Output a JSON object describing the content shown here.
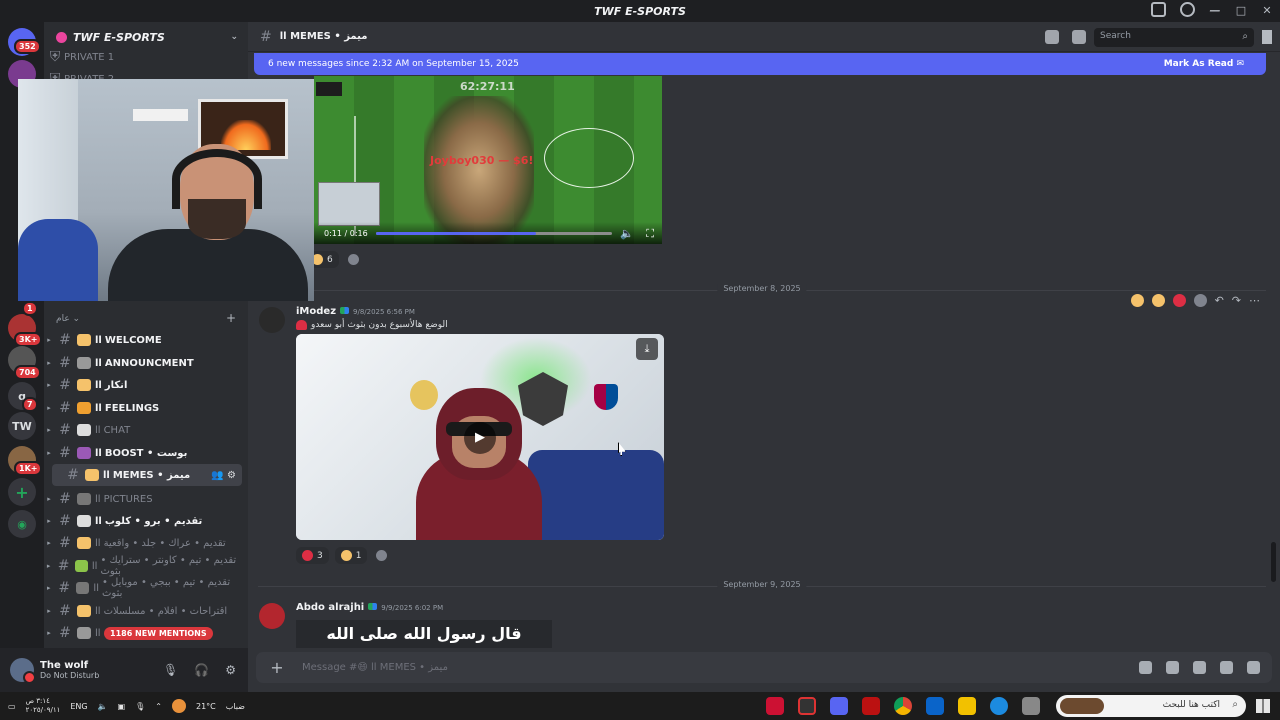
{
  "window": {
    "title": "TWF E-SPORTS",
    "controls": [
      "—",
      "□",
      "✕"
    ]
  },
  "guilds": [
    {
      "label": "",
      "badge": "352",
      "color": "#5865f2"
    },
    {
      "label": "",
      "badge": "",
      "color": "#7a3b8f"
    },
    {
      "label": "",
      "badge": "1",
      "color": "#a33"
    },
    {
      "label": "",
      "badge": "3K+",
      "color": "#4a6"
    },
    {
      "label": "",
      "badge": "704",
      "color": "#555"
    },
    {
      "label": "q",
      "badge": "7",
      "color": "#36373d"
    },
    {
      "label": "TW",
      "badge": "",
      "color": "#36373d"
    },
    {
      "label": "",
      "badge": "1K+",
      "color": "#864"
    }
  ],
  "server": {
    "name": "TWF E-SPORTS",
    "category_top": [
      "PRIVATE 1",
      "PRIVATE 2"
    ],
    "category_label": "عام"
  },
  "channels": [
    {
      "name": "WELCOME",
      "prefix": "اا",
      "emoji_color": "#f5c26b",
      "muted": false
    },
    {
      "name": "ANNOUNCMENT",
      "prefix": "اا",
      "emoji_color": "#999",
      "muted": false
    },
    {
      "name": "انكار",
      "prefix": "اا",
      "emoji_color": "#f5c26b",
      "muted": false
    },
    {
      "name": "FEELINGS",
      "prefix": "اا",
      "emoji_color": "#f0a030",
      "muted": false
    },
    {
      "name": "CHAT",
      "prefix": "اا",
      "emoji_color": "#ddd",
      "muted": true
    },
    {
      "name": "BOOST • بوست",
      "prefix": "اا",
      "emoji_color": "#9b59b6",
      "muted": false
    },
    {
      "name": "MEMES • ميمز",
      "prefix": "اا",
      "emoji_color": "#f5c26b",
      "muted": false,
      "active": true
    },
    {
      "name": "PICTURES",
      "prefix": "اا",
      "emoji_color": "#777",
      "muted": true
    },
    {
      "name": "تقديم • برو • كلوب",
      "prefix": "اا",
      "emoji_color": "#ddd",
      "muted": false
    },
    {
      "name": "تقديم • عراك • جلد • واقعية",
      "prefix": "اا",
      "emoji_color": "#f5c26b",
      "muted": true
    },
    {
      "name": "تقديم • تيم • كاونتر • سترايك • بثوث",
      "prefix": "اا",
      "emoji_color": "#8bc34a",
      "muted": true
    },
    {
      "name": "تقديم • تيم • ببجي • موبايل • بثوث",
      "prefix": "اا",
      "emoji_color": "#777",
      "muted": true
    },
    {
      "name": "اقتراحات • افلام • مسلسلات",
      "prefix": "اا",
      "emoji_color": "#f5c26b",
      "muted": true
    },
    {
      "name": "",
      "prefix": "اا",
      "emoji_color": "#999",
      "muted": true
    }
  ],
  "mentions_pill": "1186 NEW MENTIONS",
  "user": {
    "name": "The wolf",
    "status": "Do Not Disturb"
  },
  "chat": {
    "channel_title": "اا MEMES • ميمز",
    "search_placeholder": "Search",
    "new_messages": "6 new messages since 2:32 AM on September 15, 2025",
    "mark_as_read": "Mark As Read",
    "video1": {
      "overlay_timer": "62:27:11",
      "overlay_text": "Joyboy030 — $6!",
      "time": "0:11 / 0:16",
      "progress": 0.68
    },
    "video1_reactions": [
      {
        "emoji": "#f5c26b",
        "count": "6"
      }
    ],
    "dividers": [
      "September 8, 2025",
      "September 9, 2025"
    ],
    "message1": {
      "author": "iModez",
      "timestamp": "9/8/2025 6:56 PM",
      "text": "الوضع هالأسبوع بدون بثوث أبو سعدو"
    },
    "message1_reactions": [
      {
        "emoji": "#dd2e44",
        "count": "3"
      },
      {
        "emoji": "#f5c26b",
        "count": "1"
      }
    ],
    "message2": {
      "author": "Abdo alrajhi",
      "timestamp": "9/9/2025 6:02 PM",
      "caption": "قال رسول الله صلى الله"
    },
    "composer_placeholder": "Message #😄 اا MEMES • ميمز"
  },
  "taskbar": {
    "clock_time": "٣:١٤ ص",
    "clock_date": "٢٠٢٥/٠٩/١١",
    "lang": "ENG",
    "weather": "21°C",
    "weather_label": "ضباب",
    "search_placeholder": "اكتب هنا للبحث"
  }
}
